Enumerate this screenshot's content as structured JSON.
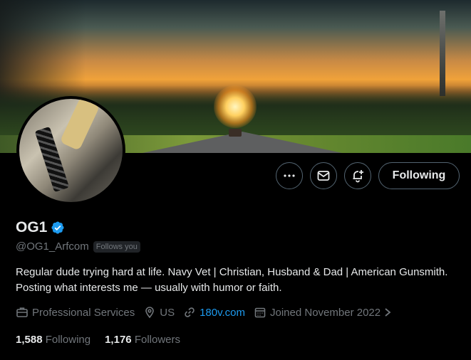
{
  "profile": {
    "name": "OG1",
    "handle": "@OG1_Arfcom",
    "follows_you": "Follows you",
    "bio": "Regular dude trying hard at life. Navy Vet | Christian, Husband & Dad | American Gunsmith. Posting what interests me — usually with humor or faith.",
    "category": "Professional Services",
    "location": "US",
    "website": "180v.com",
    "joined": "Joined November 2022",
    "following_count": "1,588",
    "following_label": "Following",
    "followers_count": "1,176",
    "followers_label": "Followers"
  },
  "actions": {
    "follow_button": "Following",
    "more_icon": "more-icon",
    "message_icon": "mail-icon",
    "notify_icon": "bell-plus-icon"
  },
  "colors": {
    "background": "#000000",
    "text": "#e7e9ea",
    "muted": "#71767b",
    "accent": "#1d9bf0",
    "border": "#536471"
  }
}
